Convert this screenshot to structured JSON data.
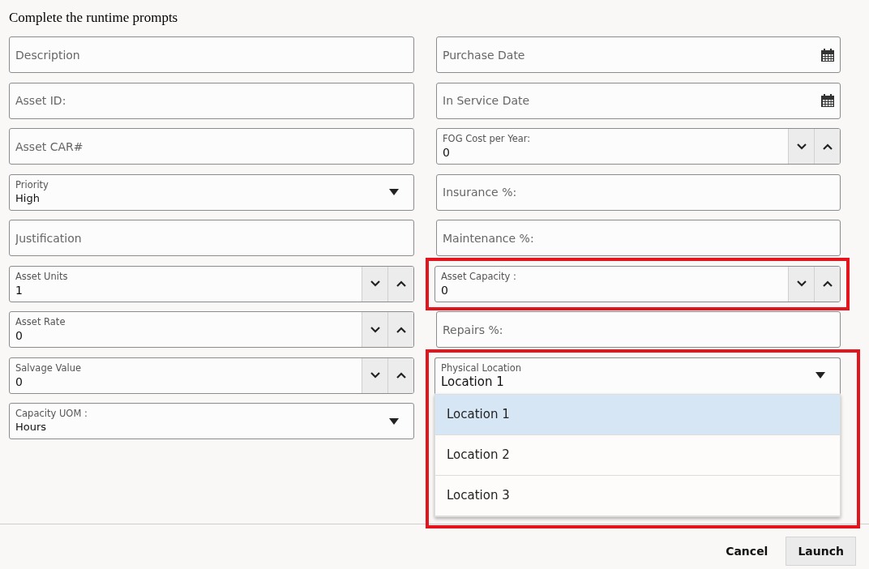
{
  "title": "Complete the runtime prompts",
  "left_fields": [
    {
      "kind": "text",
      "placeholder": "Description",
      "highlighted": false
    },
    {
      "kind": "text",
      "placeholder": "Asset ID:",
      "highlighted": false
    },
    {
      "kind": "text",
      "placeholder": "Asset CAR#",
      "highlighted": false
    },
    {
      "kind": "select",
      "label": "Priority",
      "value": "High",
      "expanded": false,
      "highlighted": false
    },
    {
      "kind": "text",
      "placeholder": "Justification",
      "highlighted": false
    },
    {
      "kind": "number",
      "label": "Asset Units",
      "value": "1",
      "highlighted": false
    },
    {
      "kind": "number",
      "label": "Asset Rate",
      "value": "0",
      "highlighted": false
    },
    {
      "kind": "number",
      "label": "Salvage Value",
      "value": "0",
      "highlighted": false
    },
    {
      "kind": "select",
      "label": "Capacity UOM :",
      "value": "Hours",
      "expanded": false,
      "highlighted": false
    }
  ],
  "right_fields": [
    {
      "kind": "date",
      "placeholder": "Purchase Date",
      "highlighted": false
    },
    {
      "kind": "date",
      "placeholder": "In Service Date",
      "highlighted": false
    },
    {
      "kind": "number",
      "label": "FOG Cost per Year:",
      "value": "0",
      "highlighted": false
    },
    {
      "kind": "text",
      "placeholder": "Insurance %:",
      "highlighted": false
    },
    {
      "kind": "text",
      "placeholder": "Maintenance %:",
      "highlighted": false
    },
    {
      "kind": "number",
      "label": "Asset Capacity :",
      "value": "0",
      "highlighted": true
    },
    {
      "kind": "text",
      "placeholder": "Repairs %:",
      "highlighted": false
    },
    {
      "kind": "select",
      "label": "Physical Location",
      "value": "Location 1",
      "expanded": true,
      "highlighted": true,
      "options": [
        {
          "label": "Location 1",
          "selected": true
        },
        {
          "label": "Location 2",
          "selected": false
        },
        {
          "label": "Location 3",
          "selected": false
        }
      ]
    }
  ],
  "buttons": [
    {
      "label": "Cancel",
      "kind": "link"
    },
    {
      "label": "Launch",
      "kind": "button"
    }
  ]
}
